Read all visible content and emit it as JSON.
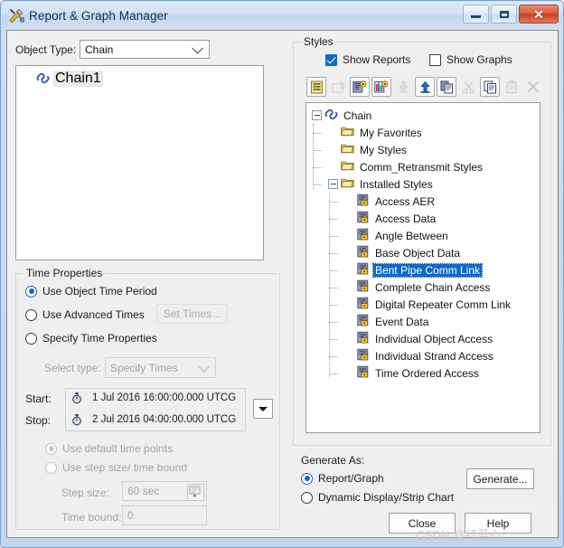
{
  "window": {
    "title": "Report & Graph Manager",
    "title_icon": "tools-icon",
    "buttons": {
      "minimize": "minimize-button",
      "maximize": "maximize-button",
      "close": "close-button"
    }
  },
  "object_type": {
    "label": "Object Type:",
    "value": "Chain",
    "list_items": [
      {
        "label": "Chain1",
        "icon": "chain-icon",
        "selected": true
      }
    ]
  },
  "time_properties": {
    "title": "Time Properties",
    "options": [
      {
        "label": "Use Object Time Period",
        "selected": true
      },
      {
        "label": "Use Advanced Times",
        "selected": false
      },
      {
        "label": "Specify Time Properties",
        "selected": false
      }
    ],
    "set_times_button": "Set Times...",
    "select_type_label": "Select type:",
    "select_type_value": "Specify Times",
    "start_label": "Start:",
    "start_value": "1 Jul 2016 16:00:00.000 UTCG",
    "stop_label": "Stop:",
    "stop_value": "2 Jul 2016 04:00:00.000 UTCG",
    "time_point_options": [
      {
        "label": "Use default time points",
        "selected": true
      },
      {
        "label": "Use step size/ time bound",
        "selected": false
      }
    ],
    "step_size_label": "Step size:",
    "step_size_value": "60 sec",
    "time_bound_label": "Time bound:",
    "time_bound_value": "0"
  },
  "styles": {
    "title": "Styles",
    "show_reports": {
      "label": "Show Reports",
      "checked": true
    },
    "show_graphs": {
      "label": "Show Graphs",
      "checked": false
    },
    "toolbar": [
      {
        "name": "new-report-icon",
        "enabled": true
      },
      {
        "name": "new-graph-icon",
        "enabled": false
      },
      {
        "name": "edit-report-style-icon",
        "enabled": true
      },
      {
        "name": "edit-graph-style-icon",
        "enabled": true
      },
      {
        "name": "import-icon",
        "enabled": false
      },
      {
        "name": "export-icon",
        "enabled": true
      },
      {
        "name": "duplicate-icon",
        "enabled": true
      },
      {
        "name": "cut-icon",
        "enabled": false
      },
      {
        "name": "copy-icon",
        "enabled": true
      },
      {
        "name": "paste-icon",
        "enabled": false
      },
      {
        "name": "delete-icon",
        "enabled": false
      }
    ],
    "tree": [
      {
        "label": "Chain",
        "icon": "chain-icon",
        "depth": 0,
        "expander": "minus",
        "selected": false
      },
      {
        "label": "My Favorites",
        "icon": "folder-icon",
        "depth": 1,
        "expander": "none",
        "selected": false
      },
      {
        "label": "My Styles",
        "icon": "folder-icon",
        "depth": 1,
        "expander": "none",
        "selected": false
      },
      {
        "label": "Comm_Retransmit Styles",
        "icon": "folder-icon",
        "depth": 1,
        "expander": "none",
        "selected": false
      },
      {
        "label": "Installed Styles",
        "icon": "folder-icon",
        "depth": 1,
        "expander": "minus",
        "selected": false
      },
      {
        "label": "Access AER",
        "icon": "style-icon",
        "depth": 2,
        "expander": "none",
        "selected": false
      },
      {
        "label": "Access Data",
        "icon": "style-icon",
        "depth": 2,
        "expander": "none",
        "selected": false
      },
      {
        "label": "Angle Between",
        "icon": "style-icon",
        "depth": 2,
        "expander": "none",
        "selected": false
      },
      {
        "label": "Base Object Data",
        "icon": "style-icon",
        "depth": 2,
        "expander": "none",
        "selected": false
      },
      {
        "label": "Bent Pipe Comm Link",
        "icon": "style-icon",
        "depth": 2,
        "expander": "none",
        "selected": true
      },
      {
        "label": "Complete Chain Access",
        "icon": "style-icon",
        "depth": 2,
        "expander": "none",
        "selected": false
      },
      {
        "label": "Digital Repeater Comm Link",
        "icon": "style-icon",
        "depth": 2,
        "expander": "none",
        "selected": false
      },
      {
        "label": "Event Data",
        "icon": "style-icon",
        "depth": 2,
        "expander": "none",
        "selected": false
      },
      {
        "label": "Individual Object Access",
        "icon": "style-icon",
        "depth": 2,
        "expander": "none",
        "selected": false
      },
      {
        "label": "Individual Strand Access",
        "icon": "style-icon",
        "depth": 2,
        "expander": "none",
        "selected": false
      },
      {
        "label": "Time Ordered Access",
        "icon": "style-icon",
        "depth": 2,
        "expander": "none",
        "selected": false
      }
    ]
  },
  "generate_as": {
    "title": "Generate As:",
    "options": [
      {
        "label": "Report/Graph",
        "selected": true
      },
      {
        "label": "Dynamic Display/Strip Chart",
        "selected": false
      }
    ],
    "generate_button": "Generate..."
  },
  "footer": {
    "close_button": "Close",
    "help_button": "Help",
    "watermark": "CSDN @红蓝心"
  },
  "colors": {
    "accent": "#1068c8",
    "selection": "#1068c8",
    "dialog_bg": "#efefef",
    "titlebar": "#cfdef0"
  }
}
